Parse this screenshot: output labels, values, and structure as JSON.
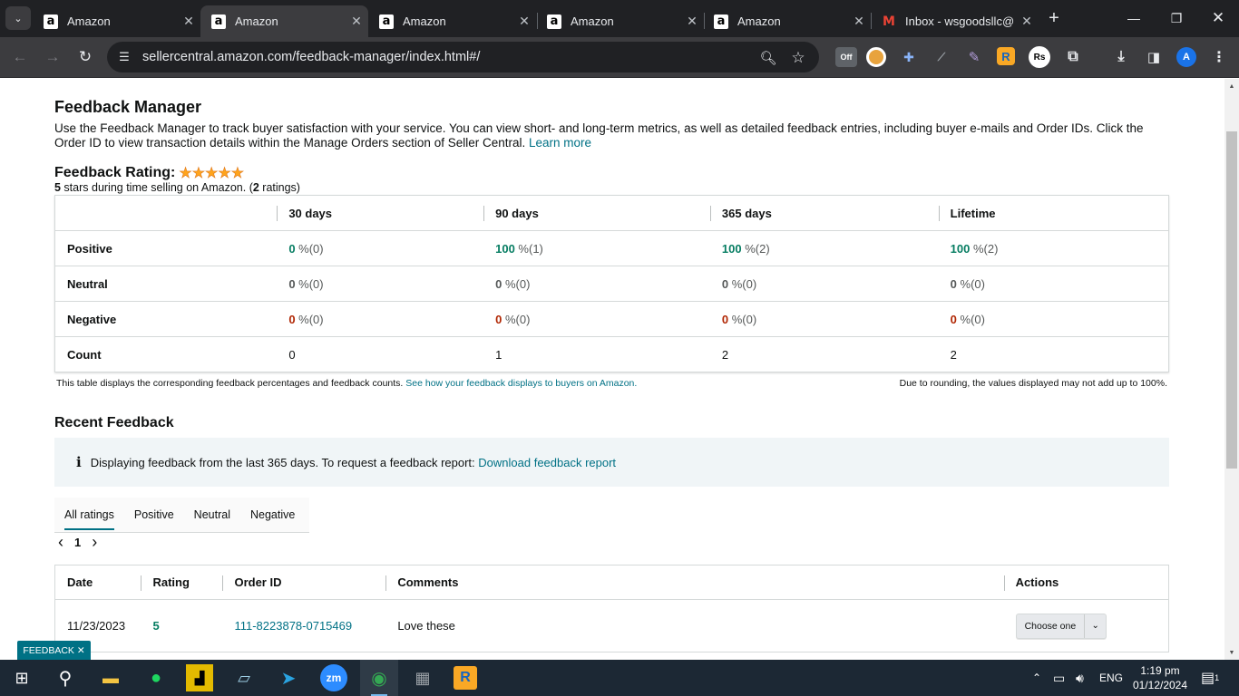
{
  "browser": {
    "tabs": [
      {
        "title": "Amazon",
        "favicon": "a",
        "active": false
      },
      {
        "title": "Amazon",
        "favicon": "a",
        "active": true
      },
      {
        "title": "Amazon",
        "favicon": "a",
        "active": false
      },
      {
        "title": "Amazon",
        "favicon": "a",
        "active": false
      },
      {
        "title": "Amazon",
        "favicon": "a",
        "active": false
      },
      {
        "title": "Inbox - wsgoodsllc@",
        "favicon": "M",
        "active": false
      }
    ],
    "url": "sellercentral.amazon.com/feedback-manager/index.html#/",
    "extension_off_label": "Off",
    "profile_initial": "A",
    "rs_label": "Rs"
  },
  "page": {
    "title": "Feedback Manager",
    "intro_text": "Use the Feedback Manager to track buyer satisfaction with your service. You can view short- and long-term metrics, as well as detailed feedback entries, including buyer e-mails and Order IDs. Click the Order ID to view transaction details within the Manage Orders section of Seller Central.",
    "learn_more": "Learn more",
    "rating_label": "Feedback Rating:",
    "stars_glyphs": "★★★★★",
    "rating_stars": "5",
    "rating_sub_mid": " stars during time selling on Amazon. (",
    "rating_count": "2",
    "rating_sub_end": " ratings)"
  },
  "metrics": {
    "columns": [
      "30 days",
      "90 days",
      "365 days",
      "Lifetime"
    ],
    "rows": [
      {
        "label": "Positive",
        "cells": [
          {
            "v": "0",
            "n": " %(0)",
            "c": "green"
          },
          {
            "v": "100",
            "n": " %(1)",
            "c": "green"
          },
          {
            "v": "100",
            "n": " %(2)",
            "c": "green"
          },
          {
            "v": "100",
            "n": " %(2)",
            "c": "green"
          }
        ]
      },
      {
        "label": "Neutral",
        "cells": [
          {
            "v": "0",
            "n": " %(0)",
            "c": "zero"
          },
          {
            "v": "0",
            "n": " %(0)",
            "c": "zero"
          },
          {
            "v": "0",
            "n": " %(0)",
            "c": "zero"
          },
          {
            "v": "0",
            "n": " %(0)",
            "c": "zero"
          }
        ]
      },
      {
        "label": "Negative",
        "cells": [
          {
            "v": "0",
            "n": " %(0)",
            "c": "red"
          },
          {
            "v": "0",
            "n": " %(0)",
            "c": "red"
          },
          {
            "v": "0",
            "n": " %(0)",
            "c": "red"
          },
          {
            "v": "0",
            "n": " %(0)",
            "c": "red"
          }
        ]
      },
      {
        "label": "Count",
        "cells": [
          {
            "v": "0",
            "n": "",
            "c": "plain"
          },
          {
            "v": "1",
            "n": "",
            "c": "plain"
          },
          {
            "v": "2",
            "n": "",
            "c": "plain"
          },
          {
            "v": "2",
            "n": "",
            "c": "plain"
          }
        ]
      }
    ],
    "note_left": "This table displays the corresponding feedback percentages and feedback counts.",
    "note_left_link": "See how your feedback displays to buyers on Amazon.",
    "note_right": "Due to rounding, the values displayed may not add up to 100%."
  },
  "recent": {
    "title": "Recent Feedback",
    "alert_icon": "i",
    "alert_text": "Displaying feedback from the last 365 days. To request a feedback report:",
    "alert_link": "Download feedback report",
    "filter_tabs": [
      "All ratings",
      "Positive",
      "Neutral",
      "Negative"
    ],
    "pager_prev": "‹",
    "pager_current": "1",
    "pager_next": "›",
    "columns": [
      "Date",
      "Rating",
      "Order ID",
      "Comments",
      "Actions"
    ],
    "rows": [
      {
        "date": "11/23/2023",
        "rating": "5",
        "order_id": "111-8223878-0715469",
        "comment": "Love these",
        "action": "Choose one"
      }
    ]
  },
  "feedback_badge": "FEEDBACK ✕",
  "taskbar": {
    "lang": "ENG",
    "time": "1:19 pm",
    "date": "01/12/2024",
    "notif_count": "1"
  },
  "colors": {
    "accent_link": "#007185",
    "positive": "#067d62",
    "negative": "#b12704",
    "star": "#ffa41c"
  }
}
